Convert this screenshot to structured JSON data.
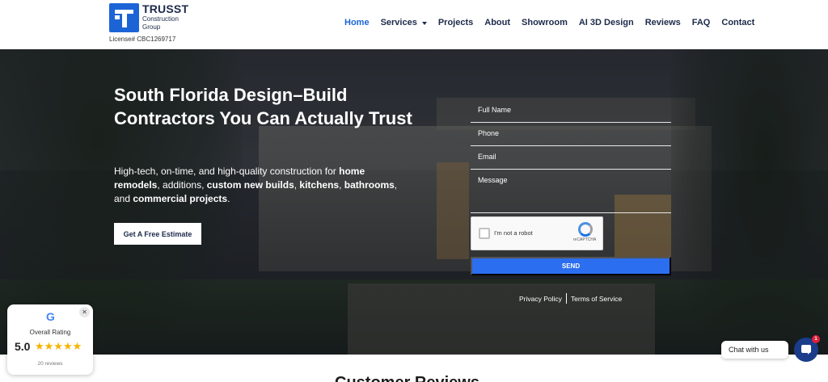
{
  "header": {
    "logo_name": "TRUSST",
    "logo_sub_1": "Construction",
    "logo_sub_2": "Group",
    "license": "License# CBC1269717",
    "nav": [
      {
        "label": "Home"
      },
      {
        "label": "Services"
      },
      {
        "label": "Projects"
      },
      {
        "label": "About"
      },
      {
        "label": "Showroom"
      },
      {
        "label": "AI 3D Design"
      },
      {
        "label": "Reviews"
      },
      {
        "label": "FAQ"
      },
      {
        "label": "Contact"
      }
    ]
  },
  "hero": {
    "title": "South Florida Design–Build Contractors You Can Actually Trust",
    "desc": {
      "p1": "High-tech, on-time, and high-quality construction for ",
      "b1": "home remodels",
      "p2": ", additions, ",
      "b2": "custom new builds",
      "p3": ", ",
      "b3": "kitchens",
      "p4": ", ",
      "b4": "bathrooms",
      "p5": ", and ",
      "b5": "commercial projects",
      "p6": "."
    },
    "cta": "Get A Free Estimate"
  },
  "form": {
    "full_name_placeholder": "Full Name",
    "phone_placeholder": "Phone",
    "email_placeholder": "Email",
    "message_placeholder": "Message",
    "recaptcha_label": "I'm not a robot",
    "recaptcha_brand": "reCAPTCHA",
    "send": "SEND",
    "privacy": "Privacy Policy",
    "terms": "Terms of Service"
  },
  "below": {
    "title": "Customer Reviews"
  },
  "rating": {
    "close": "✕",
    "google_g": "G",
    "label": "Overall Rating",
    "score": "5.0",
    "stars": "★★★★★",
    "reviews": "20 reviews"
  },
  "chat": {
    "label": "Chat with us",
    "badge": "1"
  },
  "colors": {
    "brand_blue": "#1c64d6",
    "send_blue": "#2b6ef0",
    "star": "#f5b400",
    "badge_red": "#e0203a"
  }
}
